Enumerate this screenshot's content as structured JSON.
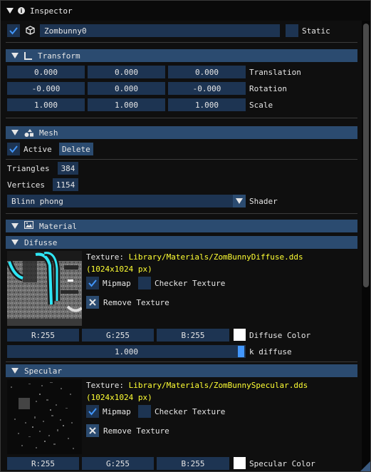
{
  "window": {
    "title": "Inspector"
  },
  "object": {
    "active": true,
    "name": "Zombunny0",
    "static_label": "Static",
    "static_checked": false
  },
  "transform": {
    "header": "Transform",
    "rows": [
      {
        "label": "Translation",
        "values": [
          "0.000",
          "0.000",
          "0.000"
        ]
      },
      {
        "label": "Rotation",
        "values": [
          "-0.000",
          "0.000",
          "-0.000"
        ]
      },
      {
        "label": "Scale",
        "values": [
          "1.000",
          "1.000",
          "1.000"
        ]
      }
    ]
  },
  "mesh": {
    "header": "Mesh",
    "active_label": "Active",
    "active_checked": true,
    "delete_label": "Delete",
    "triangles_label": "Triangles",
    "triangles_value": "384",
    "vertices_label": "Vertices",
    "vertices_value": "1154",
    "shader_value": "Blinn phong",
    "shader_label": "Shader"
  },
  "material": {
    "header": "Material",
    "diffuse": {
      "header": "Difusse",
      "texture_prefix": "Texture:",
      "texture_path": "Library/Materials/ZomBunnyDiffuse.dds",
      "texture_size": "(1024x1024 px)",
      "mipmap_label": "Mipmap",
      "mipmap_checked": true,
      "checker_label": "Checker Texture",
      "remove_label": "Remove Texture",
      "r": "R:255",
      "g": "G:255",
      "b": "B:255",
      "color_label": "Diffuse Color",
      "color_swatch": "#ffffff",
      "k_value": "1.000",
      "k_label": "k diffuse"
    },
    "specular": {
      "header": "Specular",
      "texture_prefix": "Texture:",
      "texture_path": "Library/Materials/ZomBunnySpecular.dds",
      "texture_size": "(1024x1024 px)",
      "mipmap_label": "Mipmap",
      "mipmap_checked": true,
      "checker_label": "Checker Texture",
      "remove_label": "Remove Texture",
      "r": "R:255",
      "g": "G:255",
      "b": "B:255",
      "color_label": "Specular Color",
      "color_swatch": "#ffffff"
    }
  },
  "colors": {
    "frame_bg": "#1d3452",
    "header_bg": "#2b4b70",
    "check": "#4296fa",
    "path_text": "#ffff33",
    "accent_teal": "#2ee6f5"
  },
  "icons": [
    "collapse-arrow-icon",
    "info-icon",
    "cube-icon",
    "axis-icon",
    "shapes-icon",
    "image-icon",
    "checkmark-icon",
    "x-icon",
    "dropdown-arrow-icon"
  ]
}
